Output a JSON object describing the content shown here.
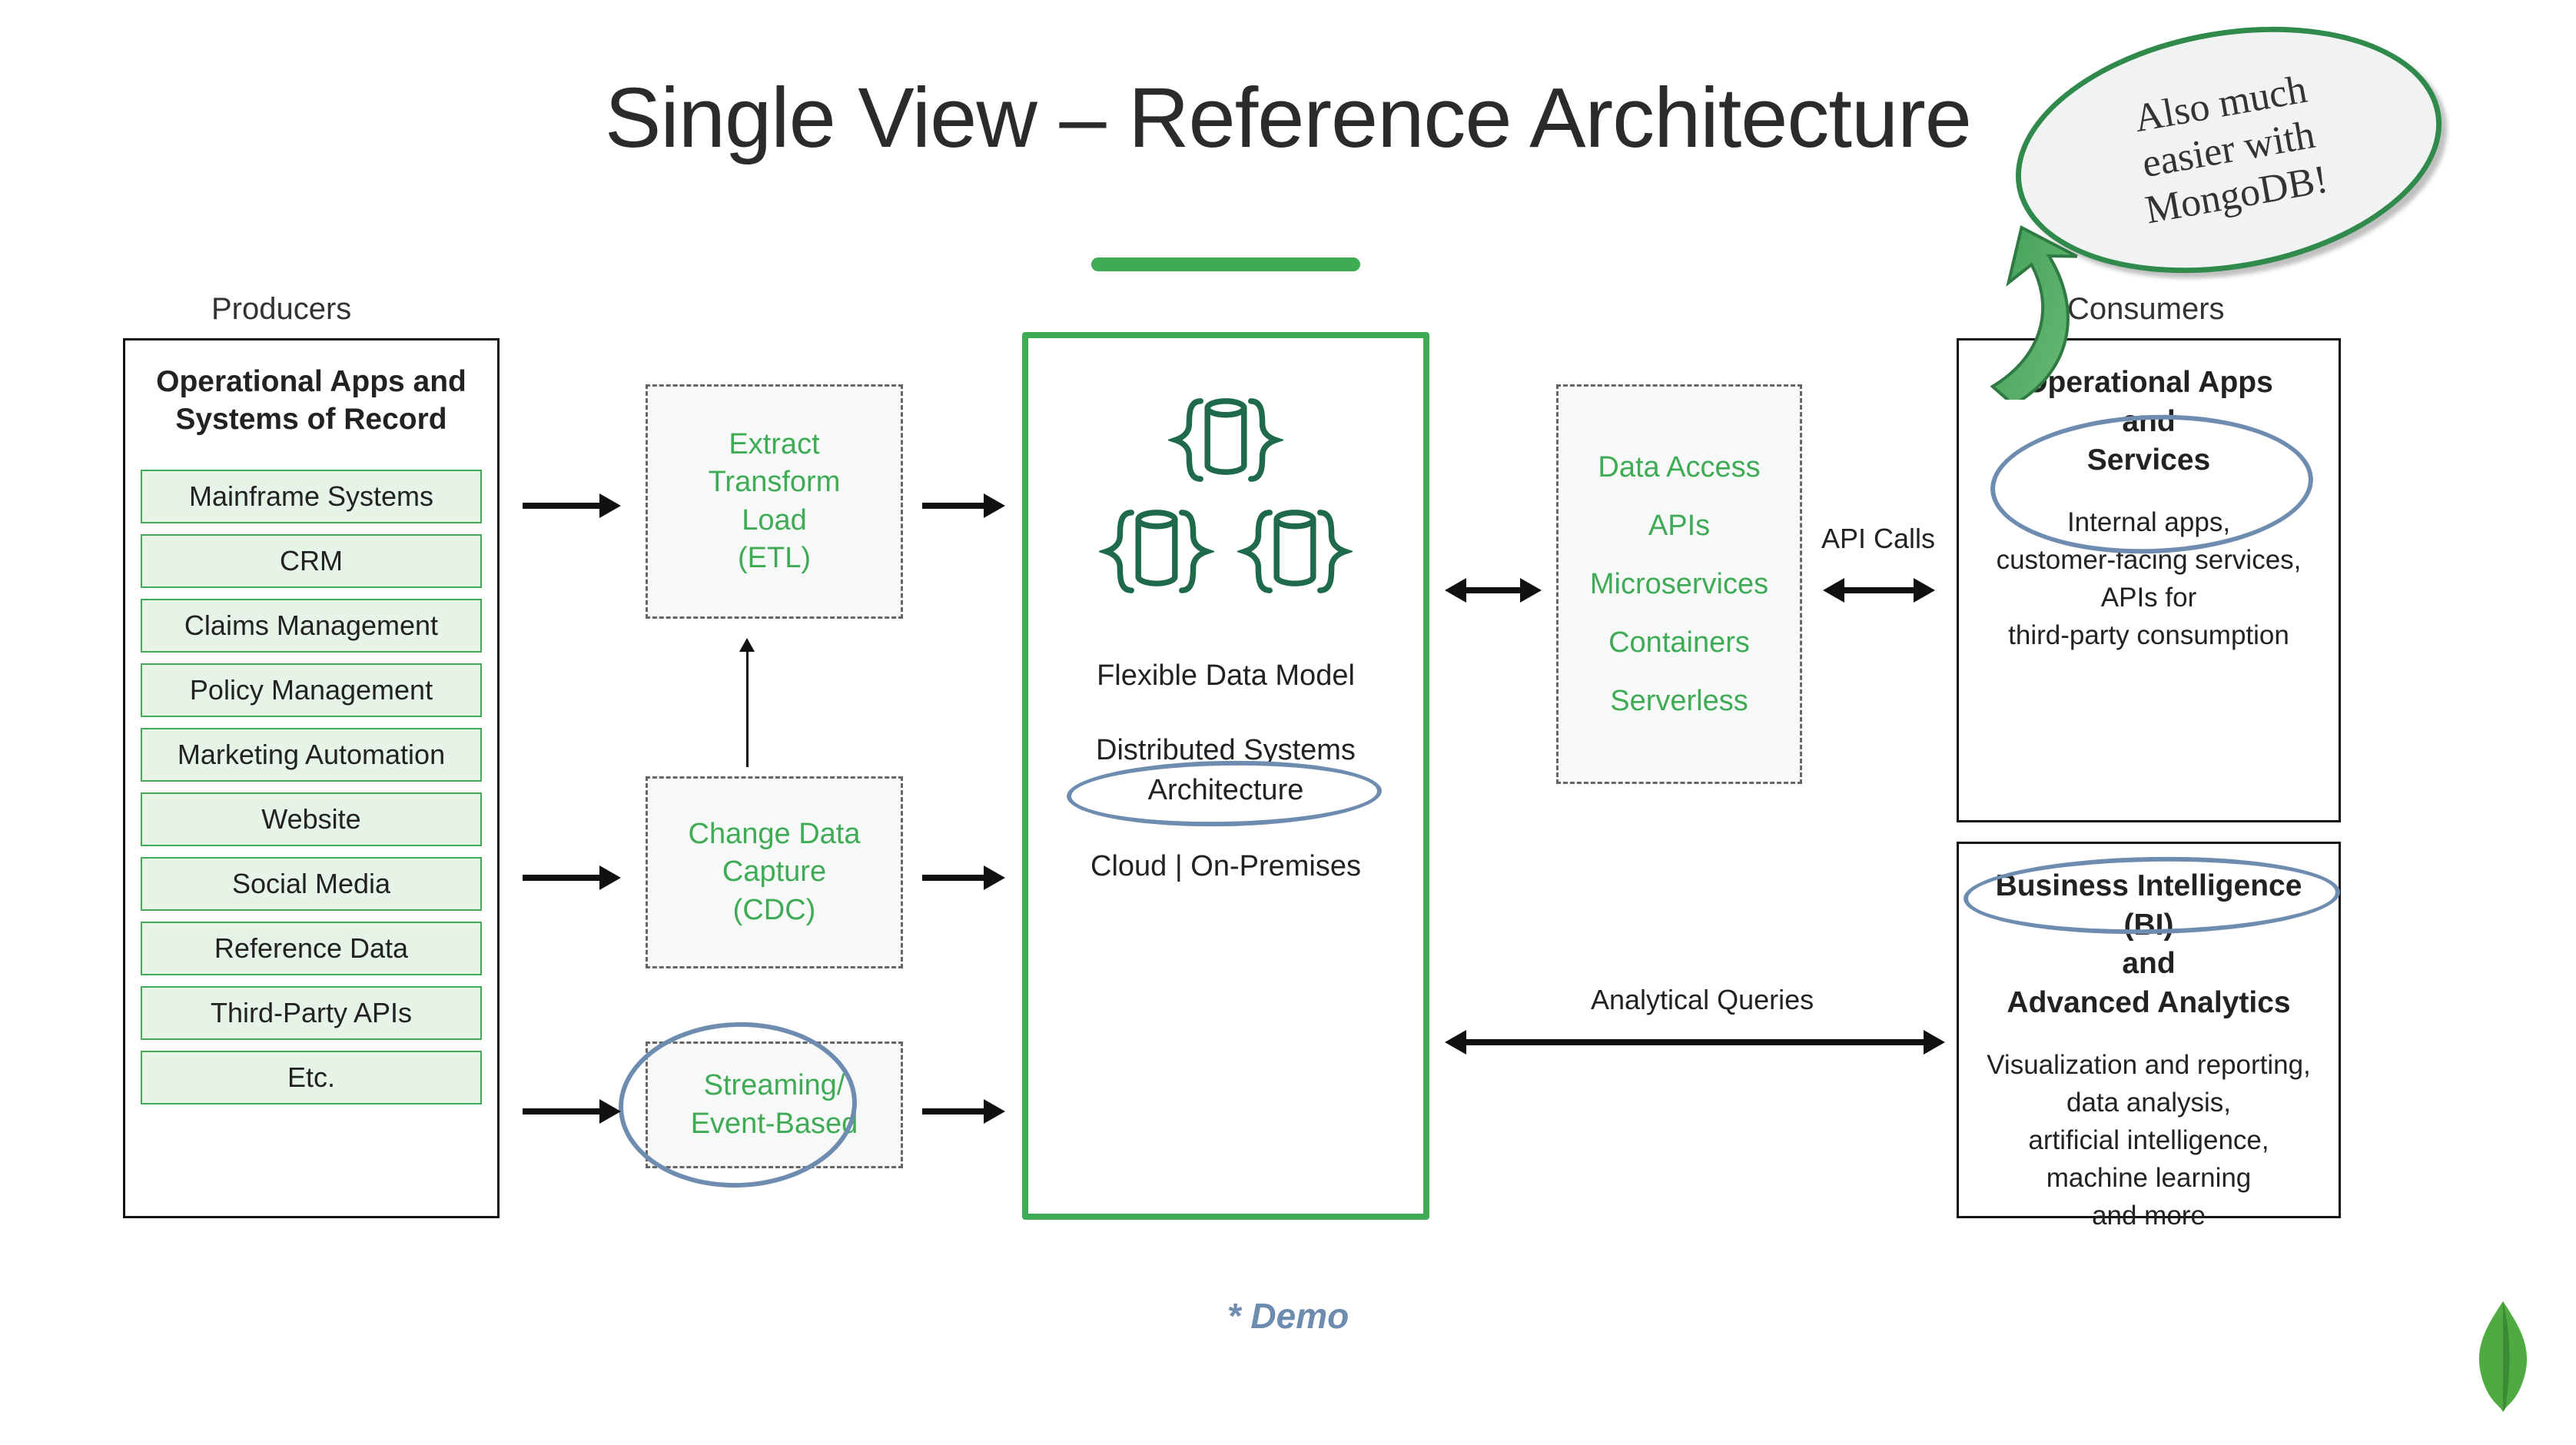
{
  "title": "Single View – Reference Architecture",
  "columns": {
    "producers": "Producers",
    "consumers": "Consumers"
  },
  "producers": {
    "heading_l1": "Operational Apps and",
    "heading_l2": "Systems of Record",
    "items": [
      "Mainframe Systems",
      "CRM",
      "Claims Management",
      "Policy Management",
      "Marketing Automation",
      "Website",
      "Social Media",
      "Reference Data",
      "Third-Party APIs",
      "Etc."
    ]
  },
  "pipeline": {
    "etl": {
      "l1": "Extract",
      "l2": "Transform",
      "l3": "Load",
      "l4": "(ETL)"
    },
    "cdc": {
      "l1": "Change Data",
      "l2": "Capture",
      "l3": "(CDC)"
    },
    "stream": {
      "l1": "Streaming/",
      "l2": "Event-Based"
    }
  },
  "central": {
    "flex_model": "Flexible Data Model",
    "dist_l1": "Distributed Systems",
    "dist_l2": "Architecture",
    "deploy": "Cloud | On-Premises"
  },
  "access": {
    "l1": "Data Access",
    "l2": "APIs",
    "l3": "Microservices",
    "l4": "Containers",
    "l5": "Serverless"
  },
  "labels": {
    "api_calls": "API Calls",
    "analytical": "Analytical Queries"
  },
  "consumers": {
    "ops": {
      "head_l1": "Operational Apps",
      "head_l2": "and",
      "head_l3": "Services",
      "body_l1": "Internal apps,",
      "body_l2": "customer-facing services,",
      "body_l3": "APIs for",
      "body_l4": "third-party consumption"
    },
    "bi": {
      "head_l1": "Business Intelligence (BI)",
      "head_l2": "and",
      "head_l3": "Advanced Analytics",
      "body_l1": "Visualization and reporting,",
      "body_l2": "data analysis,",
      "body_l3": "artificial intelligence,",
      "body_l4": "machine learning",
      "body_l5": "and more"
    }
  },
  "bubble": {
    "l1": "Also much",
    "l2": "easier with",
    "l3": "MongoDB!"
  },
  "footer": "* Demo",
  "colors": {
    "accent_green": "#3fab55",
    "dark_green": "#1f6a4a",
    "box_fill": "#e6f4e8",
    "ellipse_blue": "#6e8bb0"
  }
}
